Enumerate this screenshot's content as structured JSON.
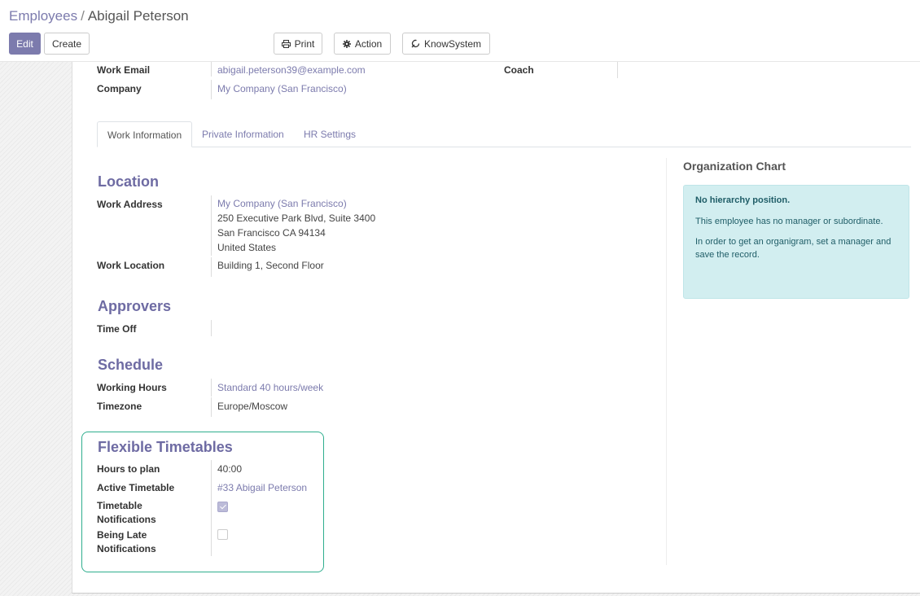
{
  "breadcrumb": {
    "parent": "Employees",
    "separator": "/",
    "current": "Abigail Peterson"
  },
  "buttons": {
    "edit": "Edit",
    "create": "Create",
    "print": "Print",
    "action": "Action",
    "knowsystem": "KnowSystem"
  },
  "header_fields": {
    "work_email_label": "Work Email",
    "work_email": "abigail.peterson39@example.com",
    "coach_label": "Coach",
    "company_label": "Company",
    "company": "My Company (San Francisco)"
  },
  "tabs": [
    "Work Information",
    "Private Information",
    "HR Settings"
  ],
  "location": {
    "title": "Location",
    "work_address_label": "Work Address",
    "address_lines": [
      "My Company (San Francisco)",
      "250 Executive Park Blvd, Suite 3400",
      "San Francisco CA 94134",
      "United States"
    ],
    "work_location_label": "Work Location",
    "work_location": "Building 1, Second Floor"
  },
  "approvers": {
    "title": "Approvers",
    "time_off_label": "Time Off",
    "time_off": ""
  },
  "schedule": {
    "title": "Schedule",
    "working_hours_label": "Working Hours",
    "working_hours": "Standard 40 hours/week",
    "timezone_label": "Timezone",
    "timezone": "Europe/Moscow"
  },
  "flexible": {
    "title": "Flexible Timetables",
    "hours_to_plan_label": "Hours to plan",
    "hours_to_plan": "40:00",
    "active_timetable_label": "Active Timetable",
    "active_timetable": "#33 Abigail Peterson",
    "timetable_notifications_label_1": "Timetable",
    "timetable_notifications_label_2": "Notifications",
    "timetable_notifications_checked": true,
    "being_late_label_1": "Being Late",
    "being_late_label_2": "Notifications",
    "being_late_checked": false
  },
  "org_chart": {
    "title": "Organization Chart",
    "alert_title": "No hierarchy position.",
    "alert_text_1": "This employee has no manager or subordinate.",
    "alert_text_2": "In order to get an organigram, set a manager and save the record."
  },
  "colors": {
    "brand": "#7c7bad",
    "highlight": "#2fae8e",
    "alert_bg": "#d2eef0"
  }
}
